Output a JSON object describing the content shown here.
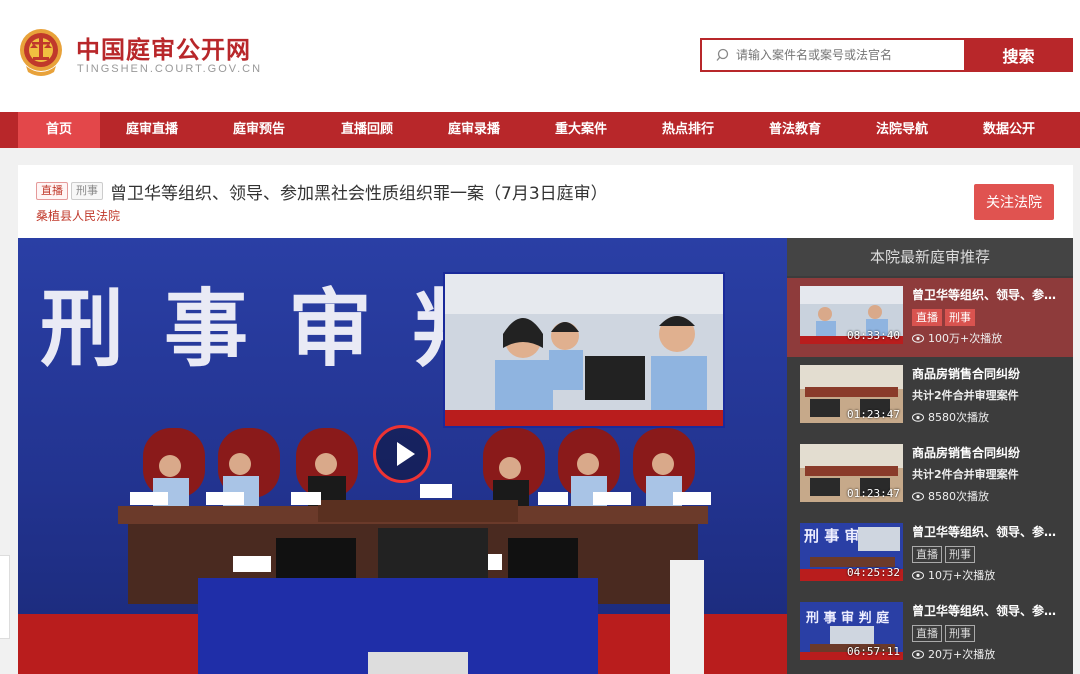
{
  "header": {
    "title": "中国庭审公开网",
    "subtitle": "TINGSHEN.COURT.GOV.CN",
    "search_placeholder": "请输入案件名或案号或法官名",
    "search_button": "搜索"
  },
  "nav": {
    "items": [
      "首页",
      "庭审直播",
      "庭审预告",
      "直播回顾",
      "庭审录播",
      "重大案件",
      "热点排行",
      "普法教育",
      "法院导航",
      "数据公开"
    ],
    "active_index": 0
  },
  "case": {
    "tag_live": "直播",
    "tag_type": "刑事",
    "title": "曾卫华等组织、领导、参加黑社会性质组织罪一案（7月3日庭审）",
    "court": "桑植县人民法院",
    "follow_button": "关注法院"
  },
  "video": {
    "backdrop_text": "刑事审判庭"
  },
  "sidebar": {
    "title": "本院最新庭审推荐",
    "items": [
      {
        "title": "曾卫华等组织、领导、参加黑社会性质组织罪一案",
        "tags": [
          "直播",
          "刑事"
        ],
        "subtitle": "",
        "duration": "08:33:40",
        "views": "100万+次播放"
      },
      {
        "title": "商品房销售合同纠纷",
        "tags": [],
        "subtitle": "共计2件合并审理案件",
        "duration": "01:23:47",
        "views": "8580次播放"
      },
      {
        "title": "商品房销售合同纠纷",
        "tags": [],
        "subtitle": "共计2件合并审理案件",
        "duration": "01:23:47",
        "views": "8580次播放"
      },
      {
        "title": "曾卫华等组织、领导、参加黑社会性质组织罪一案",
        "tags": [
          "直播",
          "刑事"
        ],
        "subtitle": "",
        "duration": "04:25:32",
        "views": "10万+次播放"
      },
      {
        "title": "曾卫华等组织、领导、参加黑社会性质组织罪一案",
        "tags": [
          "直播",
          "刑事"
        ],
        "subtitle": "",
        "duration": "06:57:11",
        "views": "20万+次播放"
      }
    ]
  },
  "colors": {
    "brand_red": "#b8272a",
    "nav_active": "#e3474a",
    "follow_btn": "#e05350"
  }
}
